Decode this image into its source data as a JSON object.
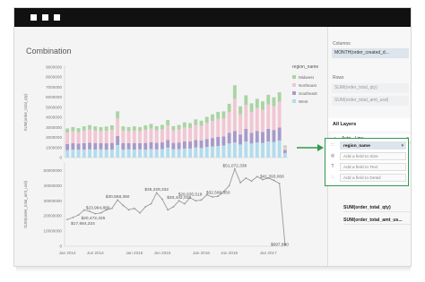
{
  "chart_title": "Combination",
  "colors": {
    "midwest": "#a9d4a4",
    "northeast": "#f2c6d3",
    "southeast": "#a79ac9",
    "west": "#b2dcec",
    "line": "#999999",
    "accent_green": "#2e9a4e"
  },
  "panel": {
    "columns_label": "Columns",
    "columns_pill": "MONTH(order_created_d...",
    "rows_label": "Rows",
    "rows_pills": [
      "SUM(order_total_qty)",
      "SUM(order_total_amt_usd)"
    ],
    "layers_title": "All Layers",
    "mark_type": "Auto - Line",
    "mark_type_icon": "line-chart-icon",
    "color_field": "region_name",
    "encodings": [
      {
        "icon": "color-icon",
        "placeholder": "Add a field to Size"
      },
      {
        "icon": "text-icon",
        "placeholder": "Add a field to Text"
      },
      {
        "icon": "detail-icon",
        "placeholder": "Add a field to Detail"
      }
    ],
    "measures": [
      "SUM(order_total_qty)",
      "SUM(order_total_amt_us..."
    ]
  },
  "chart_data": [
    {
      "type": "bar",
      "stacked": true,
      "ylabel": "SUM(order_total_qty)",
      "yticks": [
        "9000000",
        "8000000",
        "7000000",
        "6000000",
        "5000000",
        "4000000",
        "3000000",
        "2000000",
        "1000000",
        "0"
      ],
      "ylim": [
        0,
        9000000
      ],
      "legend": {
        "title": "region_name",
        "position": "right",
        "items": [
          "Midwest",
          "Northeast",
          "Southeast",
          "West"
        ]
      },
      "series": [
        {
          "name": "West",
          "values": [
            750000,
            800000,
            780000,
            800000,
            820000,
            800000,
            820000,
            780000,
            800000,
            1250000,
            800000,
            820000,
            800000,
            820000,
            800000,
            850000,
            820000,
            850000,
            1000000,
            820000,
            840000,
            900000,
            900000,
            1000000,
            950000,
            1050000,
            1100000,
            1150000,
            1200000,
            1400000,
            1500000,
            1300000,
            1600000,
            1400000,
            1500000,
            1450000,
            1600000,
            1550000,
            1700000,
            450000
          ]
        },
        {
          "name": "Southeast",
          "values": [
            600000,
            620000,
            600000,
            640000,
            660000,
            640000,
            620000,
            640000,
            660000,
            900000,
            640000,
            620000,
            640000,
            620000,
            660000,
            680000,
            640000,
            660000,
            750000,
            640000,
            660000,
            700000,
            700000,
            750000,
            750000,
            800000,
            850000,
            900000,
            900000,
            1050000,
            1150000,
            1000000,
            1250000,
            1050000,
            1150000,
            1100000,
            1250000,
            1200000,
            1300000,
            300000
          ]
        },
        {
          "name": "Northeast",
          "values": [
            1150000,
            1200000,
            1150000,
            1250000,
            1300000,
            1250000,
            1200000,
            1250000,
            1300000,
            1750000,
            1250000,
            1200000,
            1250000,
            1200000,
            1300000,
            1350000,
            1250000,
            1300000,
            1450000,
            1250000,
            1300000,
            1400000,
            1350000,
            1500000,
            1450000,
            1600000,
            1700000,
            1800000,
            1800000,
            2100000,
            3200000,
            2000000,
            2400000,
            2100000,
            2300000,
            2200000,
            2450000,
            2350000,
            2550000,
            300000
          ]
        },
        {
          "name": "Midwest",
          "values": [
            400000,
            420000,
            400000,
            420000,
            450000,
            420000,
            400000,
            420000,
            450000,
            700000,
            420000,
            400000,
            420000,
            400000,
            450000,
            470000,
            420000,
            450000,
            550000,
            420000,
            450000,
            500000,
            480000,
            550000,
            520000,
            600000,
            650000,
            700000,
            700000,
            800000,
            1350000,
            800000,
            950000,
            850000,
            900000,
            850000,
            950000,
            900000,
            950000,
            150000
          ]
        }
      ]
    },
    {
      "type": "line",
      "ylabel": "SUM(order_total_amt_usd)",
      "yticks": [
        "50000000",
        "40000000",
        "30000000",
        "20000000",
        "10000000",
        "0"
      ],
      "ylim": [
        0,
        55000000
      ],
      "x_ticks": [
        "Jan 2014",
        "Jun 2014",
        "Jan 2015",
        "Jun 2015",
        "Jan 2016",
        "Jun 2016",
        "Jan 2017"
      ],
      "values": [
        17600000,
        19000000,
        20600000,
        23900000,
        23000000,
        21500000,
        22000000,
        24000000,
        25000000,
        30500000,
        27000000,
        24000000,
        25000000,
        22000000,
        26000000,
        28000000,
        35230000,
        31000000,
        24000000,
        26000000,
        30000000,
        28000000,
        32000000,
        30000000,
        30500000,
        34000000,
        32500000,
        33000000,
        36000000,
        40000000,
        51000000,
        42000000,
        45000000,
        43000000,
        46000000,
        44000000,
        45000000,
        43500000,
        41400000,
        998000
      ],
      "data_labels": [
        {
          "index": 0,
          "text": "$17,664,324"
        },
        {
          "index": 2,
          "text": "$20,472,425"
        },
        {
          "index": 3,
          "text": "$23,964,880"
        },
        {
          "index": 9,
          "text": "$30,558,350"
        },
        {
          "index": 16,
          "text": "$35,229,332"
        },
        {
          "index": 20,
          "text": "$30,442,010"
        },
        {
          "index": 22,
          "text": "$29,935,518"
        },
        {
          "index": 27,
          "text": "$32,568,350"
        },
        {
          "index": 30,
          "text": "$51,072,338"
        },
        {
          "index": 37,
          "text": "$41,393,066"
        },
        {
          "index": 39,
          "text": "$997,890"
        }
      ]
    }
  ]
}
